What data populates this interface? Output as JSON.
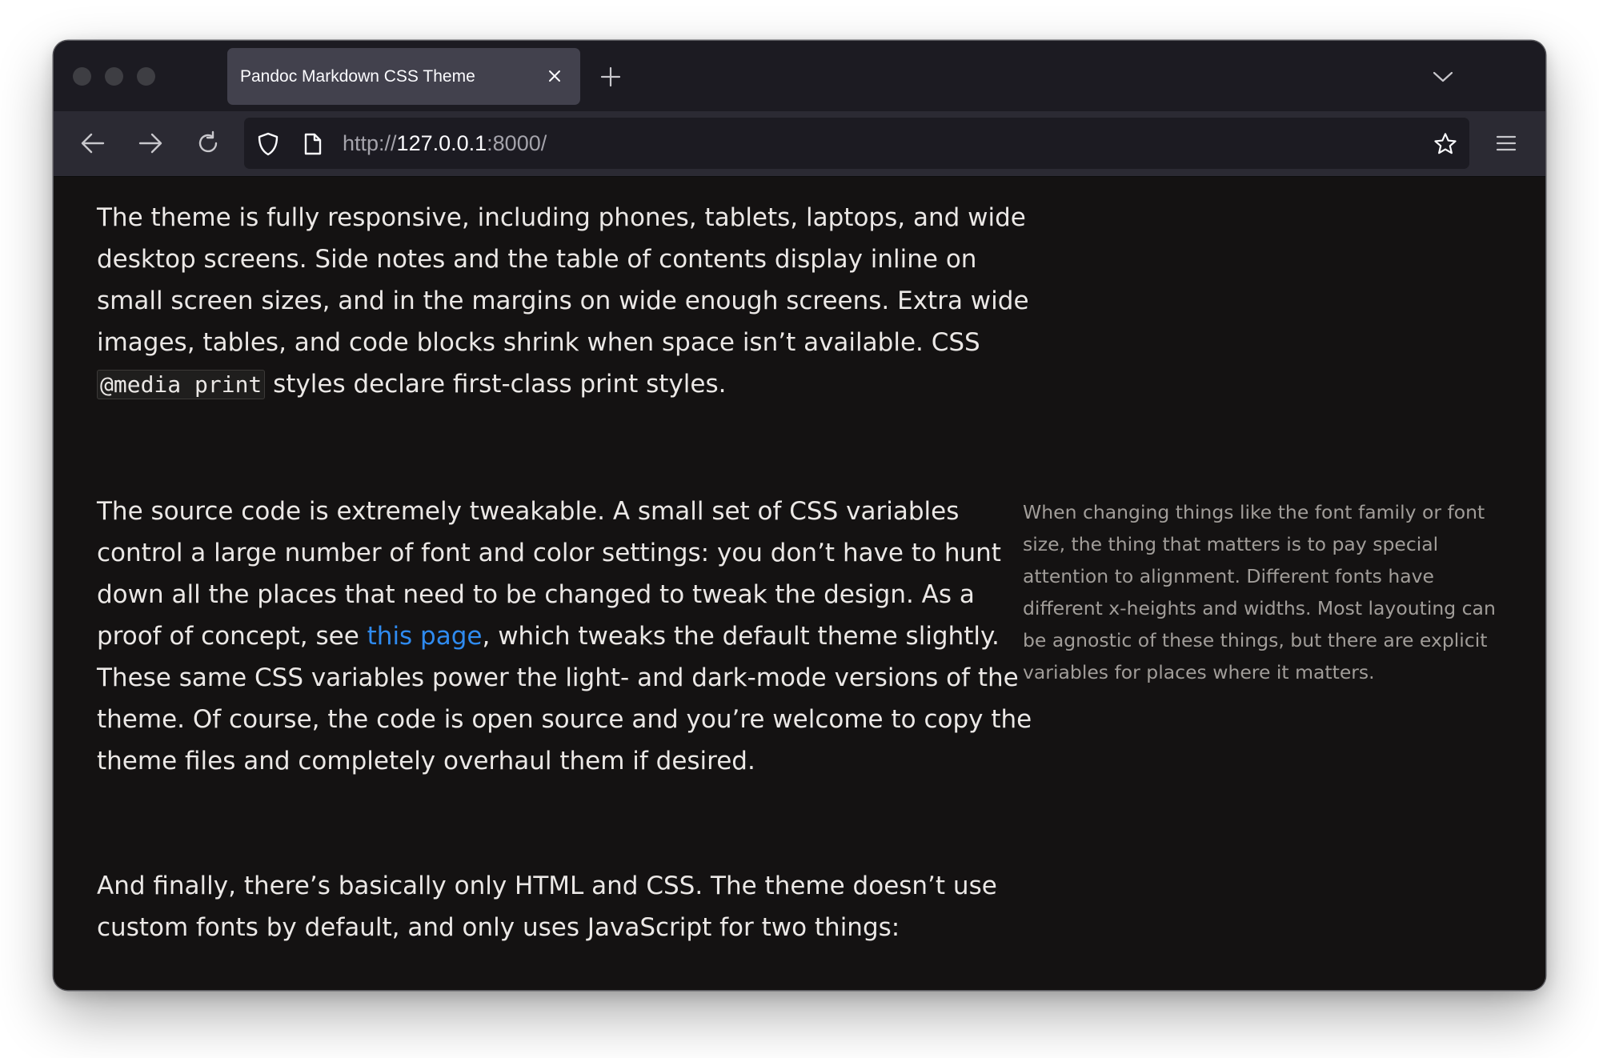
{
  "browser": {
    "tab": {
      "title": "Pandoc Markdown CSS Theme"
    },
    "url": {
      "scheme": "http://",
      "host": "127.0.0.1",
      "port_path": ":8000/"
    },
    "icons": {
      "traffic_lights": [
        "window-close-light",
        "window-minimize-light",
        "window-zoom-light"
      ],
      "tab_close": "close-icon",
      "new_tab": "plus-icon",
      "list_tabs": "chevron-down-icon",
      "back": "back-arrow-icon",
      "forward": "forward-arrow-icon",
      "reload": "reload-icon",
      "tracking_protection": "shield-icon",
      "site_info": "page-icon",
      "bookmark": "star-icon",
      "menu": "hamburger-menu-icon"
    },
    "colors": {
      "tabstrip_bg": "#1c1b22",
      "active_tab_bg": "#42414d",
      "toolbar_bg": "#2b2a33",
      "urlbar_bg": "#1c1b22",
      "page_bg": "#141212",
      "link": "#2f8bf0"
    }
  },
  "page": {
    "paragraph_1": {
      "before_code": "The theme is fully responsive, including phones, tablets, laptops, and wide desktop screens. Side notes and the table of contents display inline on small screen sizes, and in the margins on wide enough screens. Extra wide images, tables, and code blocks shrink when space isn’t available. CSS ",
      "code": "@media print",
      "after_code": " styles declare first-class print styles."
    },
    "paragraph_2": {
      "before_link": "The source code is extremely tweakable. A small set of CSS variables control a large number of font and color settings: you don’t have to hunt down all the places that need to be changed to tweak the design. As a proof of concept, see ",
      "link": "this page",
      "after_link": ", which tweaks the default theme slightly. These same CSS variables power the light- and dark-mode versions of the theme. Of course, the code is open source and you’re welcome to copy the theme files and completely overhaul them if desired."
    },
    "sidenote": "When changing things like the font family or font size, the thing that matters is to pay special attention to alignment. Different fonts have different x-heights and widths. Most layouting can be agnostic of these things, but there are explicit variables for places where it matters.",
    "paragraph_3": "And finally, there’s basically only HTML and CSS. The theme doesn’t use custom fonts by default, and only uses JavaScript for two things:"
  }
}
